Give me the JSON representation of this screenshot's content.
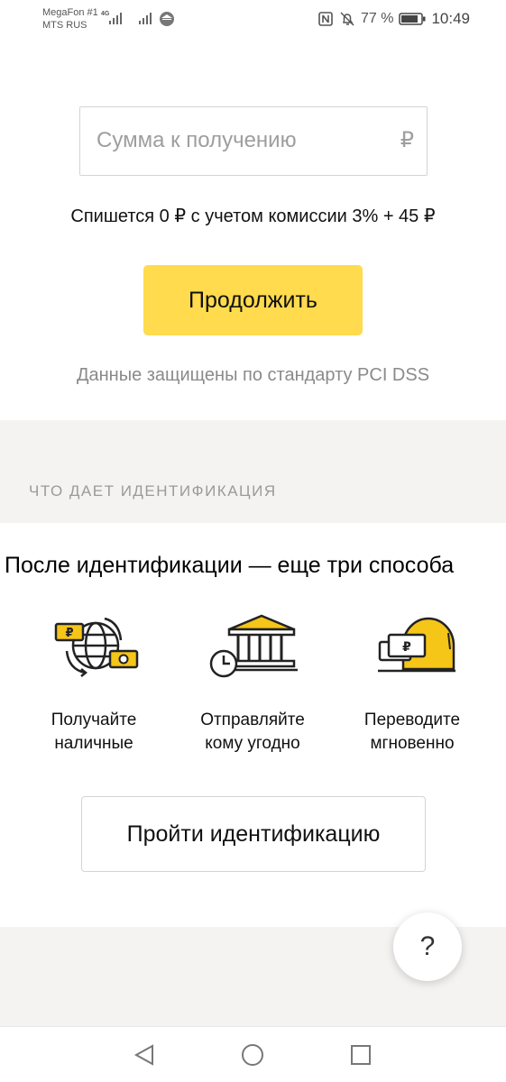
{
  "status_bar": {
    "carrier1": "MegaFon #1",
    "carrier2": "MTS RUS",
    "network": "4G",
    "battery": "77 %",
    "time": "10:49",
    "icons": [
      "nfc-icon",
      "bell-off-icon",
      "battery-icon"
    ]
  },
  "form": {
    "amount_placeholder": "Сумма к получению",
    "currency_symbol": "₽",
    "fee_text": "Спишется 0  ₽ с учетом комиссии 3% + 45 ₽",
    "continue_label": "Продолжить",
    "security_note": "Данные защищены по стандарту PCI DSS"
  },
  "identification": {
    "section_label": "ЧТО ДАЕТ ИДЕНТИФИКАЦИЯ",
    "title": "После идентификации — еще три способа",
    "features": [
      {
        "line1": "Получайте",
        "line2": "наличные",
        "icon": "cash-globe-icon"
      },
      {
        "line1": "Отправляйте",
        "line2": "кому угодно",
        "icon": "bank-clock-icon"
      },
      {
        "line1": "Переводите",
        "line2": "мгновенно",
        "icon": "instant-transfer-icon"
      }
    ],
    "button_label": "Пройти идентификацию"
  },
  "help": {
    "label": "?"
  },
  "nav": {
    "icons": [
      "back-icon",
      "home-icon",
      "recents-icon"
    ]
  },
  "colors": {
    "accent": "#ffdb4d",
    "band": "#f4f3f1",
    "icon_yellow": "#f5c518"
  }
}
